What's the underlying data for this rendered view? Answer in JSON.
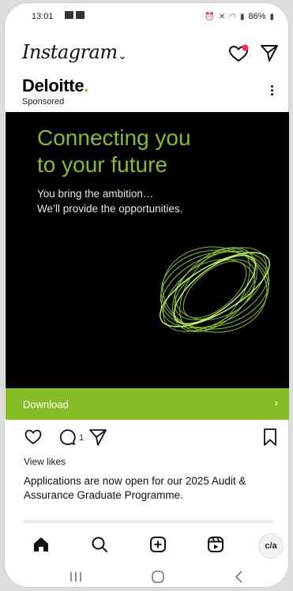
{
  "status_bar": {
    "time": "13:01",
    "battery": "86%"
  },
  "app": {
    "logo": "Instagram",
    "switcher_glyph": "⌄",
    "notification_dot_color": "#ff2d55"
  },
  "post": {
    "account": "Deloitte",
    "account_dot": ".",
    "label": "Sponsored",
    "ad_headline_line1": "Connecting you",
    "ad_headline_line2": "to your future",
    "ad_subline1": "You bring the ambition…",
    "ad_subline2": "We’ll provide the opportunities.",
    "cta_label": "Download",
    "cta_arrow": "›",
    "comment_count": "1",
    "view_likes": "View likes",
    "caption": "Applications are now open for our 2025 Audit & Assurance Graduate Programme."
  },
  "bottom_nav": {
    "avatar_text": "c/a"
  },
  "colors": {
    "brand_green": "#86bc25",
    "ad_background": "#000000"
  },
  "icons": [
    "heart-icon",
    "send-icon",
    "more-icon",
    "comment-icon",
    "bookmark-icon",
    "home-icon",
    "search-icon",
    "create-icon",
    "reels-icon",
    "recents-icon",
    "home-button-icon",
    "back-icon"
  ]
}
